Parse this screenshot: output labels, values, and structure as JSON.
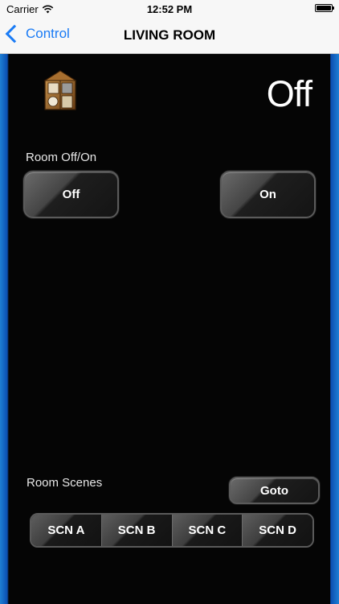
{
  "status_bar": {
    "carrier": "Carrier",
    "time": "12:52 PM",
    "wifi_icon": "wifi-icon",
    "battery_icon": "battery-icon"
  },
  "nav": {
    "back_label": "Control",
    "title": "LIVING ROOM"
  },
  "room": {
    "status": "Off",
    "icon": "house-icon",
    "on_off_label": "Room Off/On",
    "off_button": "Off",
    "on_button": "On"
  },
  "scenes": {
    "label": "Room Scenes",
    "goto_button": "Goto",
    "buttons": [
      "SCN A",
      "SCN B",
      "SCN C",
      "SCN D"
    ]
  },
  "colors": {
    "accent": "#1a7bf5",
    "panel_edge": "#1e7fd4",
    "background": "#050505"
  }
}
